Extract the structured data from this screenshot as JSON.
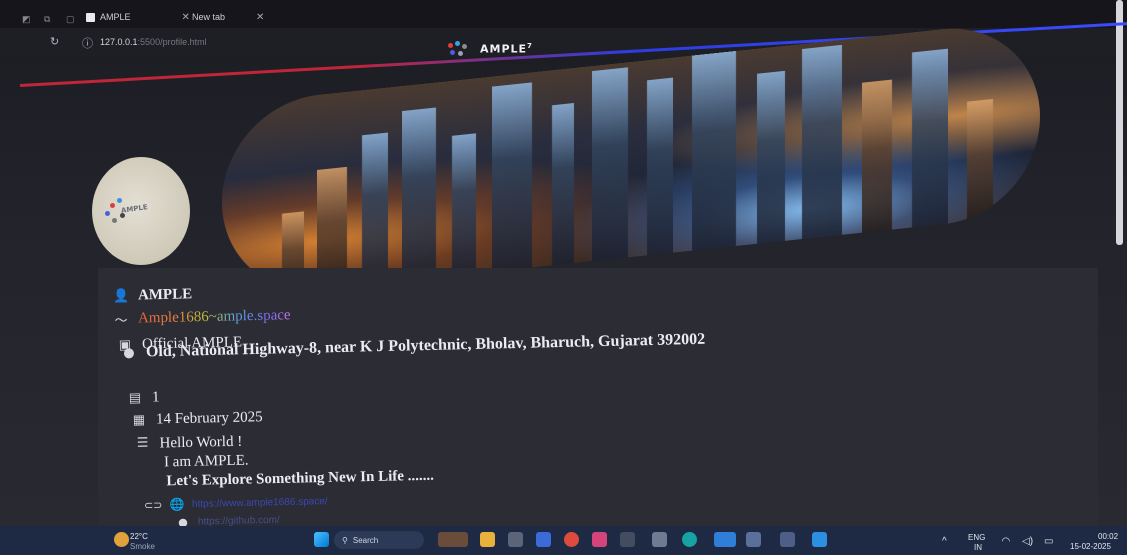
{
  "browser": {
    "tabs": [
      {
        "label": "AMPLE",
        "active": true
      },
      {
        "label": "New tab",
        "active": false
      }
    ],
    "url": {
      "host": "127.0.0.1",
      "path": ":5500/profile.html"
    }
  },
  "site": {
    "brand_name": "AMPLE",
    "brand_sup": "7",
    "avatar_word": "AMPLE"
  },
  "profile": {
    "name": "AMPLE",
    "handle": "Ample1686~ample.space",
    "title": "Official AMPLE",
    "address": "Old, National Highway-8, near K J Polytechnic, Bholav, Bharuch, Gujarat 392002",
    "count": "1",
    "date": "14 February 2025",
    "bio": [
      "Hello World !",
      "I am AMPLE.",
      "Let's Explore Something New In Life ......."
    ],
    "website": "https://www.ample1686.space/",
    "github": "https://github.com/"
  },
  "taskbar": {
    "weather": {
      "temp": "22°C",
      "cond": "Smoke"
    },
    "search_label": "Search",
    "lang": [
      "ENG",
      "IN"
    ],
    "time": "00:02",
    "date": "15-02-2025"
  },
  "colors": {
    "accent_red": "#c0253a",
    "accent_blue": "#3a4bff",
    "page_bg": "#2c2c35",
    "taskbar_bg": "#1e2a44"
  }
}
